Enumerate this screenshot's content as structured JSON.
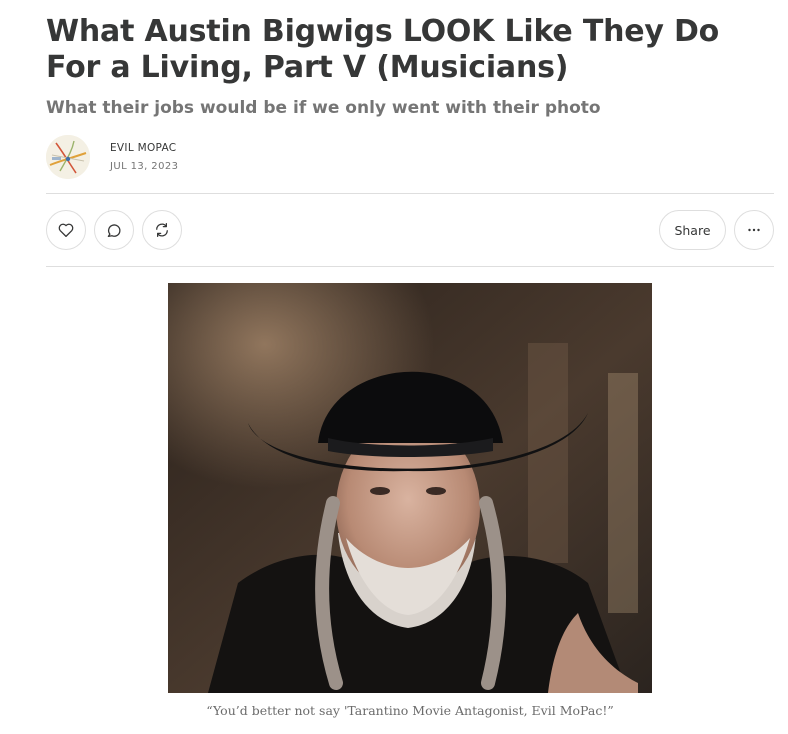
{
  "post": {
    "title": "What Austin Bigwigs LOOK Like They Do For a Living, Part V (Musicians)",
    "subtitle": "What their jobs would be if we only went with their photo"
  },
  "byline": {
    "author": "EVIL MOPAC",
    "date": "JUL 13, 2023"
  },
  "actions": {
    "like_icon": "heart-icon",
    "comment_icon": "comment-bubble-icon",
    "restack_icon": "restack-icon",
    "share_label": "Share",
    "more_icon": "ellipsis-icon"
  },
  "figure": {
    "caption": "“You’d better not say 'Tarantino Movie Antagonist, Evil MoPac!”"
  },
  "colors": {
    "text": "#363737",
    "muted": "#757575",
    "border": "#dedede",
    "background": "#ffffff"
  }
}
